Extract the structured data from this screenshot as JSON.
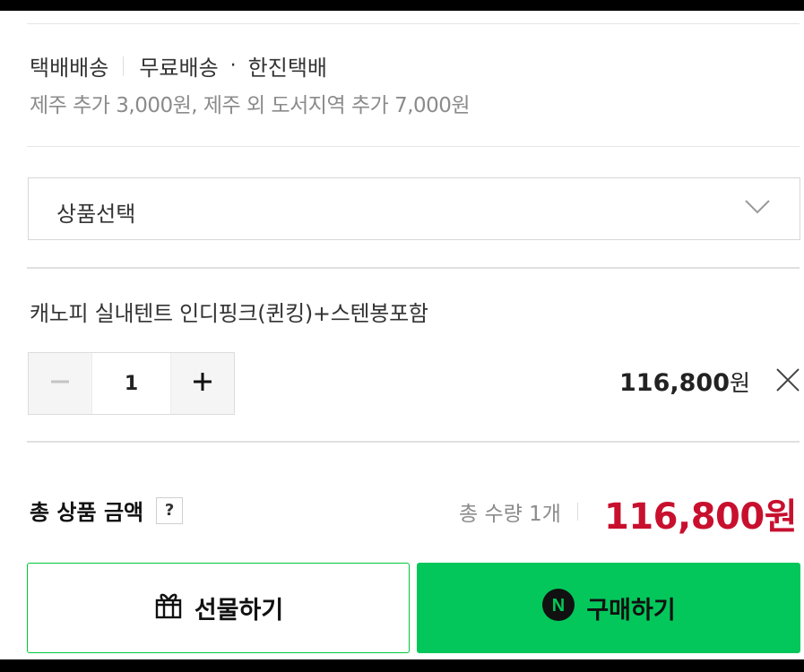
{
  "shipping": {
    "label": "택배배송",
    "fee": "무료배송",
    "dot": "·",
    "courier": "한진택배",
    "extra": "제주 추가 3,000원, 제주 외 도서지역 추가 7,000원"
  },
  "option_select": {
    "label": "상품선택",
    "icon": "chevron-down-icon"
  },
  "selected_option": {
    "name": "캐노피 실내텐트 인디핑크(퀸킹)+스텐봉포함",
    "quantity": "1",
    "price": "116,800",
    "currency": "원",
    "minus_icon": "minus-icon",
    "plus_icon": "plus-icon",
    "remove_icon": "close-icon"
  },
  "total": {
    "label": "총 상품 금액",
    "help": "?",
    "quantity_text": "총 수량 1개",
    "price": "116,800원"
  },
  "buttons": {
    "gift": "선물하기",
    "gift_icon": "gift-icon",
    "buy": "구매하기",
    "buy_icon": "naver-n-icon",
    "buy_icon_letter": "N"
  },
  "colors": {
    "accent_green": "#03c75a",
    "price_red": "#c8102e"
  }
}
